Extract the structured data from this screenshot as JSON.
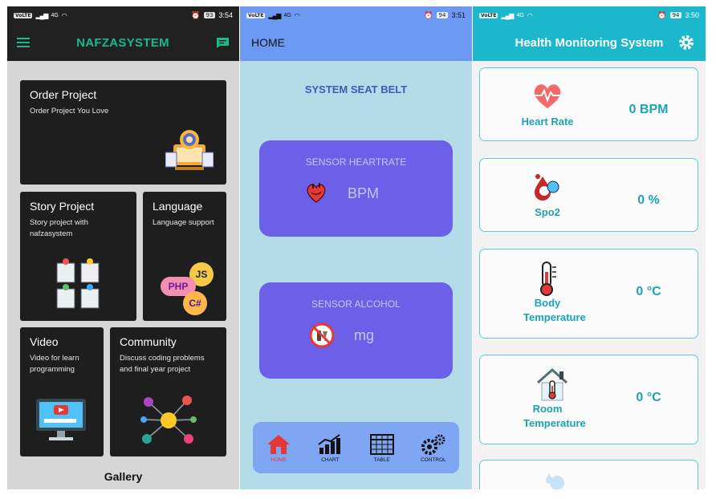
{
  "phone1": {
    "status": {
      "carrier": "VoLTE",
      "signal": "4G",
      "battery": "93",
      "time": "3:54"
    },
    "app_title": "NAFZASYSTEM",
    "cards": [
      {
        "title": "Order Project",
        "desc": "Order Project You Love"
      },
      {
        "title": "Story Project",
        "desc": "Story project with nafzasystem"
      },
      {
        "title": "Language",
        "desc": "Language support"
      },
      {
        "title": "Video",
        "desc": "Video for learn programming"
      },
      {
        "title": "Community",
        "desc": "Discuss coding problems and final year project"
      }
    ],
    "lang_badges": {
      "js": "JS",
      "php": "PHP",
      "csharp": "C#"
    },
    "gallery": "Gallery"
  },
  "phone2": {
    "status": {
      "carrier": "VoLTE",
      "signal": "4G",
      "battery": "94",
      "time": "3:51"
    },
    "app_title": "HOME",
    "section_title": "SYSTEM SEAT BELT",
    "sensors": [
      {
        "label": "SENSOR HEARTRATE",
        "unit": "BPM",
        "icon": "heart-organ-icon"
      },
      {
        "label": "SENSOR ALCOHOL",
        "unit": "mg",
        "icon": "no-alcohol-icon"
      }
    ],
    "nav": [
      {
        "label": "HOME",
        "icon": "home-icon",
        "active": true
      },
      {
        "label": "CHART",
        "icon": "chart-icon",
        "active": false
      },
      {
        "label": "TABLE",
        "icon": "table-icon",
        "active": false
      },
      {
        "label": "CONTROL",
        "icon": "gears-icon",
        "active": false
      }
    ]
  },
  "phone3": {
    "status": {
      "carrier": "VoLTE",
      "signal": "4G",
      "battery": "94",
      "time": "3:50"
    },
    "app_title": "Health Monitoring System",
    "metrics": [
      {
        "name": "Heart Rate",
        "value": "0 BPM",
        "icon": "heart-rate-icon"
      },
      {
        "name": "Spo2",
        "value": "0 %",
        "icon": "spo2-icon"
      },
      {
        "name": "Body Temperature",
        "value": "0 °C",
        "icon": "thermometer-icon"
      },
      {
        "name": "Room Temperature",
        "value": "0 °C",
        "icon": "house-thermometer-icon"
      }
    ]
  },
  "colors": {
    "teal_accent": "#18b98e",
    "dark_card": "#1e1e1e",
    "blue_appbar": "#6c9af2",
    "purple_sensor": "#6c60e8",
    "cyan_appbar": "#1bb7cc",
    "cyan_text": "#1ca3b5"
  }
}
